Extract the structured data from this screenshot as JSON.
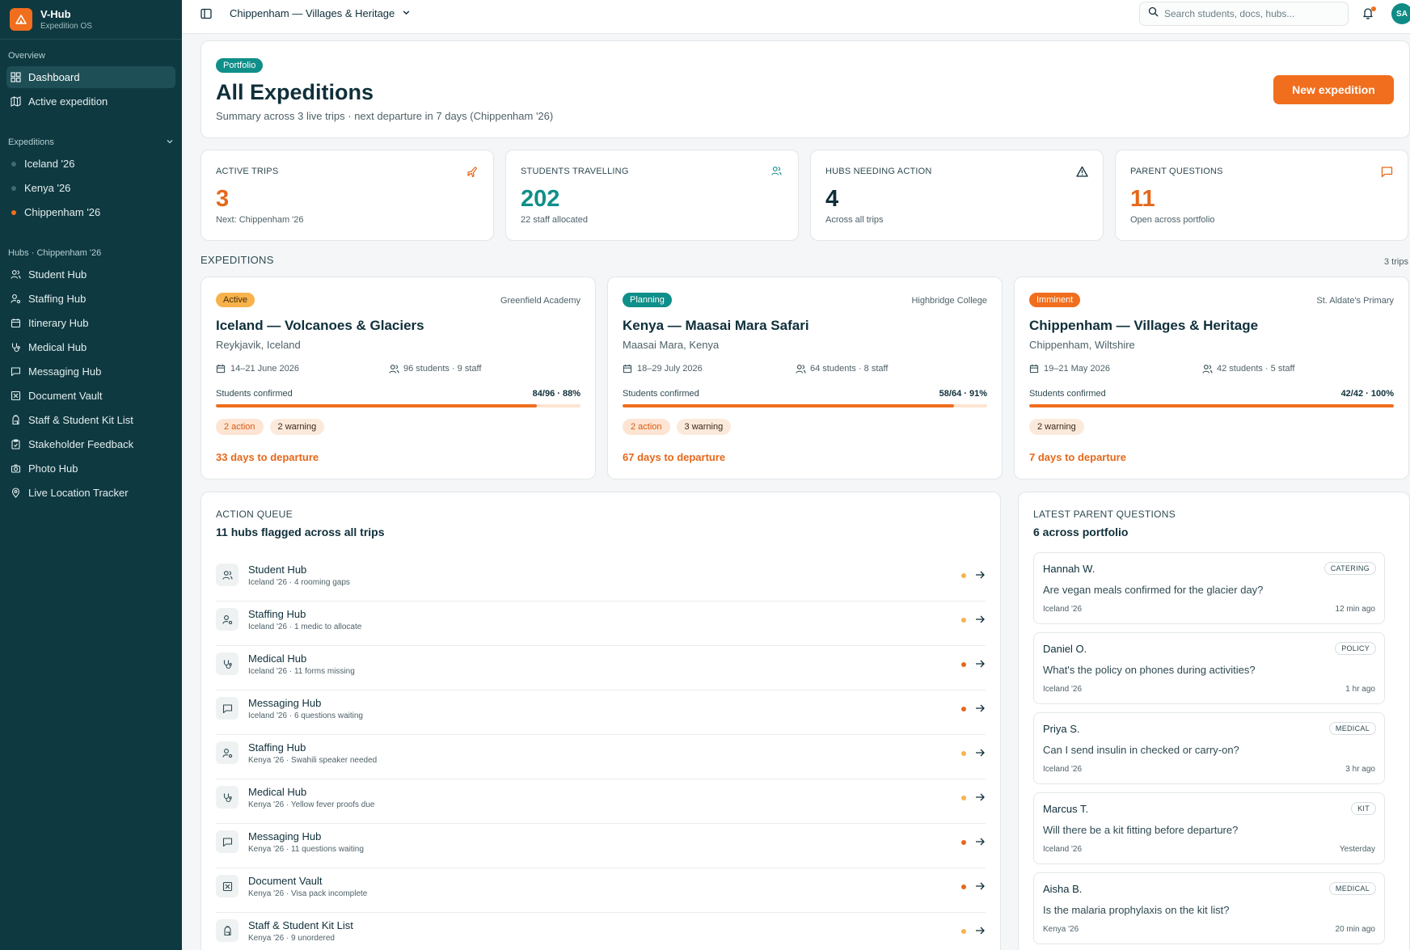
{
  "brand": {
    "name": "V-Hub",
    "subtitle": "Expedition OS"
  },
  "sidebar": {
    "overview_label": "Overview",
    "overview_items": [
      {
        "label": "Dashboard",
        "icon": "grid-icon",
        "active": true
      },
      {
        "label": "Active expedition",
        "icon": "map-icon",
        "active": false
      }
    ],
    "expeditions_label": "Expeditions",
    "expeditions": [
      {
        "label": "Iceland '26",
        "dot_color": "#3f6a70"
      },
      {
        "label": "Kenya '26",
        "dot_color": "#3f6a70"
      },
      {
        "label": "Chippenham '26",
        "dot_color": "#f06e1d"
      }
    ],
    "hubs_label": "Hubs · Chippenham '26",
    "hubs": [
      {
        "label": "Student Hub",
        "icon": "users-icon"
      },
      {
        "label": "Staffing Hub",
        "icon": "user-cog-icon"
      },
      {
        "label": "Itinerary Hub",
        "icon": "calendar-icon"
      },
      {
        "label": "Medical Hub",
        "icon": "stethoscope-icon"
      },
      {
        "label": "Messaging Hub",
        "icon": "message-icon"
      },
      {
        "label": "Document Vault",
        "icon": "vault-icon"
      },
      {
        "label": "Staff & Student Kit List",
        "icon": "backpack-icon"
      },
      {
        "label": "Stakeholder Feedback",
        "icon": "clipboard-icon"
      },
      {
        "label": "Photo Hub",
        "icon": "camera-icon"
      },
      {
        "label": "Live Location Tracker",
        "icon": "pin-icon"
      }
    ]
  },
  "topbar": {
    "title": "Chippenham — Villages & Heritage",
    "search_placeholder": "Search students, docs, hubs...",
    "avatar_initials": "SA"
  },
  "header": {
    "badge": "Portfolio",
    "title": "All Expeditions",
    "subtitle": "Summary across 3 live trips · next departure in 7 days (Chippenham '26)",
    "new_button": "New expedition"
  },
  "stats": [
    {
      "label": "ACTIVE TRIPS",
      "value": "3",
      "sub": "Next: Chippenham '26",
      "color": "#e5681a",
      "icon": "plane-icon"
    },
    {
      "label": "STUDENTS TRAVELLING",
      "value": "202",
      "sub": "22 staff allocated",
      "color": "#0f8f89",
      "icon": "users-icon"
    },
    {
      "label": "HUBS NEEDING ACTION",
      "value": "4",
      "sub": "Across all trips",
      "color": "#0f2f3a",
      "icon": "alert-icon"
    },
    {
      "label": "PARENT QUESTIONS",
      "value": "11",
      "sub": "Open across portfolio",
      "color": "#e5681a",
      "icon": "chat-icon"
    }
  ],
  "expeditions_section": {
    "label": "EXPEDITIONS",
    "count": "3 trips"
  },
  "trips": [
    {
      "status": "Active",
      "status_style": "amber",
      "school": "Greenfield Academy",
      "name": "Iceland — Volcanoes & Glaciers",
      "location": "Reykjavik, Iceland",
      "dates": "14–21 June 2026",
      "people": "96 students · 9 staff",
      "confirm_label": "Students confirmed",
      "confirm_value": "84/96 · 88%",
      "progress": 0.88,
      "action_chip": "2 action",
      "warning_chip": "2 warning",
      "days": "33 days to departure"
    },
    {
      "status": "Planning",
      "status_style": "teal",
      "school": "Highbridge College",
      "name": "Kenya — Maasai Mara Safari",
      "location": "Maasai Mara, Kenya",
      "dates": "18–29 July 2026",
      "people": "64 students · 8 staff",
      "confirm_label": "Students confirmed",
      "confirm_value": "58/64 · 91%",
      "progress": 0.91,
      "action_chip": "2 action",
      "warning_chip": "3 warning",
      "days": "67 days to departure"
    },
    {
      "status": "Imminent",
      "status_style": "orange",
      "school": "St. Aldate's Primary",
      "name": "Chippenham — Villages & Heritage",
      "location": "Chippenham, Wiltshire",
      "dates": "19–21 May 2026",
      "people": "42 students · 5 staff",
      "confirm_label": "Students confirmed",
      "confirm_value": "42/42 · 100%",
      "progress": 1.0,
      "action_chip": "",
      "warning_chip": "2 warning",
      "days": "7 days to departure"
    }
  ],
  "queue": {
    "label": "ACTION QUEUE",
    "title": "11 hubs flagged across all trips",
    "rows": [
      {
        "name": "Student Hub",
        "sub": "Iceland '26 · 4 rooming gaps",
        "icon": "users-icon",
        "dot": "#f7b24b"
      },
      {
        "name": "Staffing Hub",
        "sub": "Iceland '26 · 1 medic to allocate",
        "icon": "user-cog-icon",
        "dot": "#f7b24b"
      },
      {
        "name": "Medical Hub",
        "sub": "Iceland '26 · 11 forms missing",
        "icon": "stethoscope-icon",
        "dot": "#e5681a"
      },
      {
        "name": "Messaging Hub",
        "sub": "Iceland '26 · 6 questions waiting",
        "icon": "message-icon",
        "dot": "#e5681a"
      },
      {
        "name": "Staffing Hub",
        "sub": "Kenya '26 · Swahili speaker needed",
        "icon": "user-cog-icon",
        "dot": "#f7b24b"
      },
      {
        "name": "Medical Hub",
        "sub": "Kenya '26 · Yellow fever proofs due",
        "icon": "stethoscope-icon",
        "dot": "#f7b24b"
      },
      {
        "name": "Messaging Hub",
        "sub": "Kenya '26 · 11 questions waiting",
        "icon": "message-icon",
        "dot": "#e5681a"
      },
      {
        "name": "Document Vault",
        "sub": "Kenya '26 · Visa pack incomplete",
        "icon": "vault-icon",
        "dot": "#e5681a"
      },
      {
        "name": "Staff & Student Kit List",
        "sub": "Kenya '26 · 9 unordered",
        "icon": "backpack-icon",
        "dot": "#f7b24b"
      }
    ]
  },
  "parent_questions": {
    "label": "LATEST PARENT QUESTIONS",
    "title": "6 across portfolio",
    "items": [
      {
        "name": "Hannah W.",
        "tag": "CATERING",
        "question": "Are vegan meals confirmed for the glacier day?",
        "trip": "Iceland '26",
        "time": "12 min ago"
      },
      {
        "name": "Daniel O.",
        "tag": "POLICY",
        "question": "What's the policy on phones during activities?",
        "trip": "Iceland '26",
        "time": "1 hr ago"
      },
      {
        "name": "Priya S.",
        "tag": "MEDICAL",
        "question": "Can I send insulin in checked or carry-on?",
        "trip": "Iceland '26",
        "time": "3 hr ago"
      },
      {
        "name": "Marcus T.",
        "tag": "KIT",
        "question": "Will there be a kit fitting before departure?",
        "trip": "Iceland '26",
        "time": "Yesterday"
      },
      {
        "name": "Aisha B.",
        "tag": "MEDICAL",
        "question": "Is the malaria prophylaxis on the kit list?",
        "trip": "Kenya '26",
        "time": "20 min ago"
      }
    ]
  },
  "colors": {
    "sidebar": "#0f3940",
    "accent": "#f06e1d",
    "teal": "#0f8f89"
  }
}
